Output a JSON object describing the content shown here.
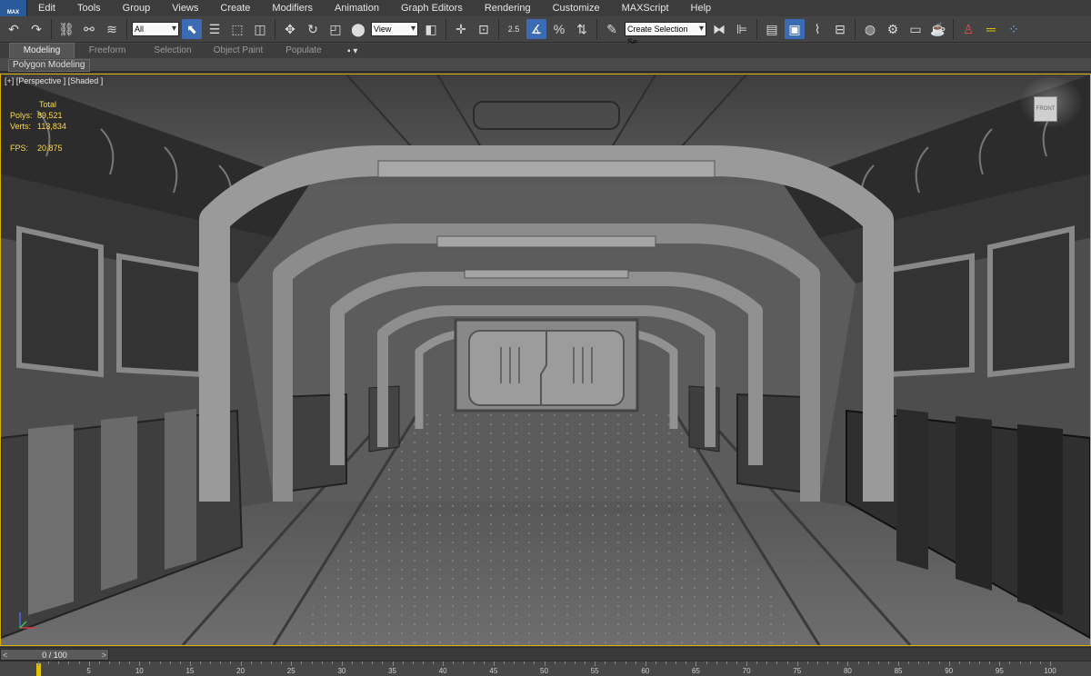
{
  "app": {
    "logo_text": "MAX"
  },
  "menu": [
    "Edit",
    "Tools",
    "Group",
    "Views",
    "Create",
    "Modifiers",
    "Animation",
    "Graph Editors",
    "Rendering",
    "Customize",
    "MAXScript",
    "Help"
  ],
  "toolbar": {
    "selection_filter": "All",
    "reference_coord": "View",
    "named_selection_placeholder": "Create Selection Se",
    "snap_label": "2.5"
  },
  "ribbon": {
    "tabs": [
      "Modeling",
      "Freeform",
      "Selection",
      "Object Paint",
      "Populate"
    ],
    "active_tab": "Modeling",
    "panel_label": "Polygon Modeling"
  },
  "viewport": {
    "label": "[+] [Perspective ] [Shaded ]",
    "stats": {
      "header": "Total",
      "polys_label": "Polys:",
      "polys_value": "89,521",
      "verts_label": "Verts:",
      "verts_value": "113,834",
      "fps_label": "FPS:",
      "fps_value": "20.875"
    },
    "viewcube_label": "FRONT"
  },
  "timeline": {
    "slider_label": "0 / 100",
    "prev": "<",
    "next": ">",
    "current_frame": 0,
    "total_frames": 100
  },
  "trackbar": {
    "ticks": [
      5,
      10,
      15,
      20,
      25,
      30,
      35,
      40,
      45,
      50,
      55,
      60,
      65,
      70,
      75,
      80,
      85,
      90,
      95,
      100
    ]
  },
  "colors": {
    "active_border": "#d8b100",
    "accent": "#3b6cb3",
    "stats_text": "#ffd84a"
  }
}
